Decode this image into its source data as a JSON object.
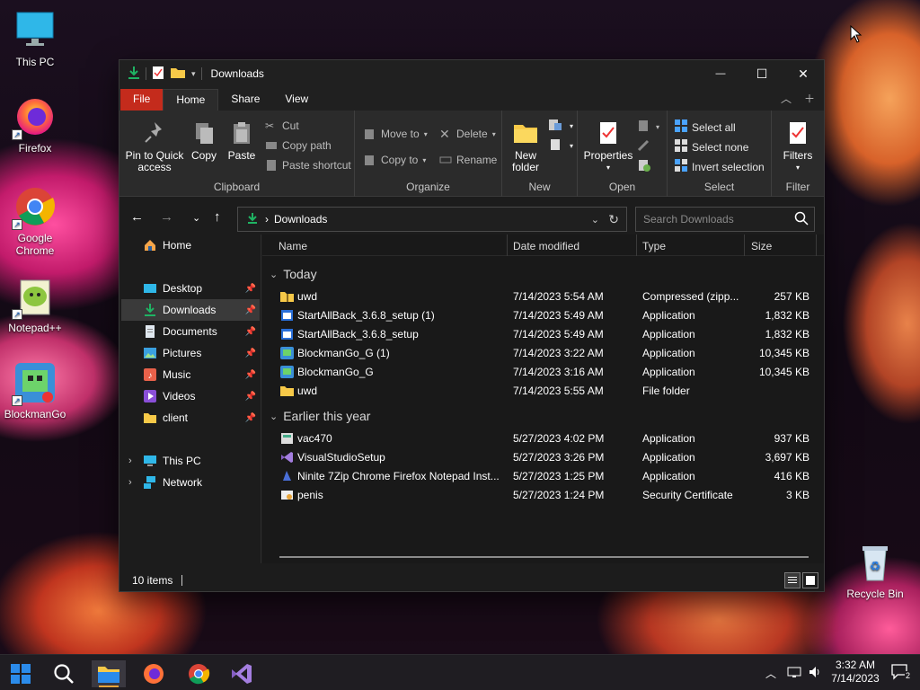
{
  "desktop": {
    "icons": [
      {
        "label": "This PC"
      },
      {
        "label": "Firefox"
      },
      {
        "label": "Google Chrome"
      },
      {
        "label": "Notepad++"
      },
      {
        "label": "BlockmanGo"
      },
      {
        "label": "Recycle Bin"
      }
    ]
  },
  "window": {
    "title": "Downloads",
    "controls": {
      "minimize": "—",
      "maximize": "☐",
      "close": "✕"
    },
    "tabs": [
      "File",
      "Home",
      "Share",
      "View"
    ],
    "active_tab": "Home",
    "ribbon": {
      "clipboard": {
        "pin": "Pin to Quick access",
        "pin_line1": "Pin to Quick",
        "pin_line2": "access",
        "copy": "Copy",
        "paste": "Paste",
        "cut": "Cut",
        "copy_path": "Copy path",
        "paste_shortcut": "Paste shortcut",
        "group": "Clipboard"
      },
      "organize": {
        "move_to": "Move to",
        "copy_to": "Copy to",
        "delete": "Delete",
        "rename": "Rename",
        "group": "Organize"
      },
      "new": {
        "new_folder_line1": "New",
        "new_folder_line2": "folder",
        "group": "New"
      },
      "open": {
        "properties": "Properties",
        "group": "Open"
      },
      "select": {
        "select_all": "Select all",
        "select_none": "Select none",
        "invert": "Invert selection",
        "group": "Select"
      },
      "filter": {
        "filters": "Filters",
        "group": "Filter"
      }
    },
    "address": {
      "path": "Downloads",
      "separator": "›"
    },
    "search": {
      "placeholder": "Search Downloads"
    },
    "nav": {
      "home": "Home",
      "quick": [
        {
          "label": "Desktop",
          "icon": "desktop-icon",
          "pinned": true
        },
        {
          "label": "Downloads",
          "icon": "download-icon",
          "pinned": true,
          "selected": true
        },
        {
          "label": "Documents",
          "icon": "documents-icon",
          "pinned": true
        },
        {
          "label": "Pictures",
          "icon": "pictures-icon",
          "pinned": true
        },
        {
          "label": "Music",
          "icon": "music-icon",
          "pinned": true
        },
        {
          "label": "Videos",
          "icon": "videos-icon",
          "pinned": true
        },
        {
          "label": "client",
          "icon": "folder-icon",
          "pinned": true
        }
      ],
      "this_pc": "This PC",
      "network": "Network"
    },
    "columns": {
      "name": "Name",
      "date": "Date modified",
      "type": "Type",
      "size": "Size"
    },
    "groups": [
      {
        "label": "Today",
        "files": [
          {
            "name": "uwd",
            "date": "7/14/2023 5:54 AM",
            "type": "Compressed (zipp...",
            "size": "257 KB",
            "icon": "zip-folder-icon"
          },
          {
            "name": "StartAllBack_3.6.8_setup (1)",
            "date": "7/14/2023 5:49 AM",
            "type": "Application",
            "size": "1,832 KB",
            "icon": "app-icon"
          },
          {
            "name": "StartAllBack_3.6.8_setup",
            "date": "7/14/2023 5:49 AM",
            "type": "Application",
            "size": "1,832 KB",
            "icon": "app-icon"
          },
          {
            "name": "BlockmanGo_G (1)",
            "date": "7/14/2023 3:22 AM",
            "type": "Application",
            "size": "10,345 KB",
            "icon": "blockman-icon"
          },
          {
            "name": "BlockmanGo_G",
            "date": "7/14/2023 3:16 AM",
            "type": "Application",
            "size": "10,345 KB",
            "icon": "blockman-icon"
          },
          {
            "name": "uwd",
            "date": "7/14/2023 5:55 AM",
            "type": "File folder",
            "size": "",
            "icon": "folder-icon"
          }
        ]
      },
      {
        "label": "Earlier this year",
        "files": [
          {
            "name": "vac470",
            "date": "5/27/2023 4:02 PM",
            "type": "Application",
            "size": "937 KB",
            "icon": "installer-icon"
          },
          {
            "name": "VisualStudioSetup",
            "date": "5/27/2023 3:26 PM",
            "type": "Application",
            "size": "3,697 KB",
            "icon": "visual-studio-icon"
          },
          {
            "name": "Ninite 7Zip Chrome Firefox Notepad Inst...",
            "date": "5/27/2023 1:25 PM",
            "type": "Application",
            "size": "416 KB",
            "icon": "ninite-icon"
          },
          {
            "name": "penis",
            "date": "5/27/2023 1:24 PM",
            "type": "Security Certificate",
            "size": "3 KB",
            "icon": "certificate-icon"
          }
        ]
      }
    ],
    "status": {
      "items": "10 items"
    }
  },
  "taskbar": {
    "apps": [
      "start-button",
      "search-button",
      "file-explorer",
      "firefox",
      "chrome",
      "visual-studio"
    ],
    "time": "3:32 AM",
    "date": "7/14/2023",
    "notifications": "2"
  },
  "colors": {
    "accent_file_tab": "#c42b1c",
    "window_bg": "#1c1c1c",
    "folder_yellow": "#f7c948",
    "download_green": "#1fb363"
  }
}
